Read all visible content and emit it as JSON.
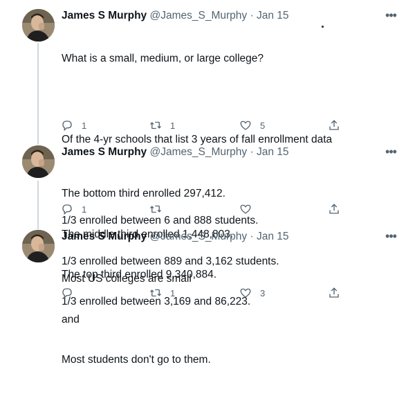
{
  "tweets": [
    {
      "name": "James S Murphy",
      "handle": "@James_S_Murphy",
      "separator": "·",
      "date": "Jan 15",
      "lines": [
        "What is a small, medium, or large college?",
        "",
        "Of the 4-yr schools that list 3 years of fall enrollment data",
        "",
        "1/3 enrolled between 6 and 888 students.",
        "1/3 enrolled between 889 and 3,162 students.",
        "1/3 enrolled between 3,169 and 86,223."
      ],
      "replies": "1",
      "retweets": "1",
      "likes": "5"
    },
    {
      "name": "James S Murphy",
      "handle": "@James_S_Murphy",
      "separator": "·",
      "date": "Jan 15",
      "lines": [
        "The bottom third enrolled 297,412.",
        "The middle third enrolled 1,448,803.",
        "The top third enrolled 9,340,884."
      ],
      "replies": "1",
      "retweets": "",
      "likes": ""
    },
    {
      "name": "James S Murphy",
      "handle": "@James_S_Murphy",
      "separator": "·",
      "date": "Jan 15",
      "lines": [
        "Most US colleges are small",
        "and",
        "Most students don't go to them."
      ],
      "replies": "",
      "retweets": "1",
      "likes": "3"
    }
  ],
  "icons": {
    "more": "more-horizontal-icon",
    "reply": "reply-icon",
    "retweet": "retweet-icon",
    "like": "heart-icon",
    "share": "share-icon"
  },
  "colors": {
    "text": "#0f1419",
    "secondary": "#536471",
    "thread_line": "#cfd9de"
  }
}
